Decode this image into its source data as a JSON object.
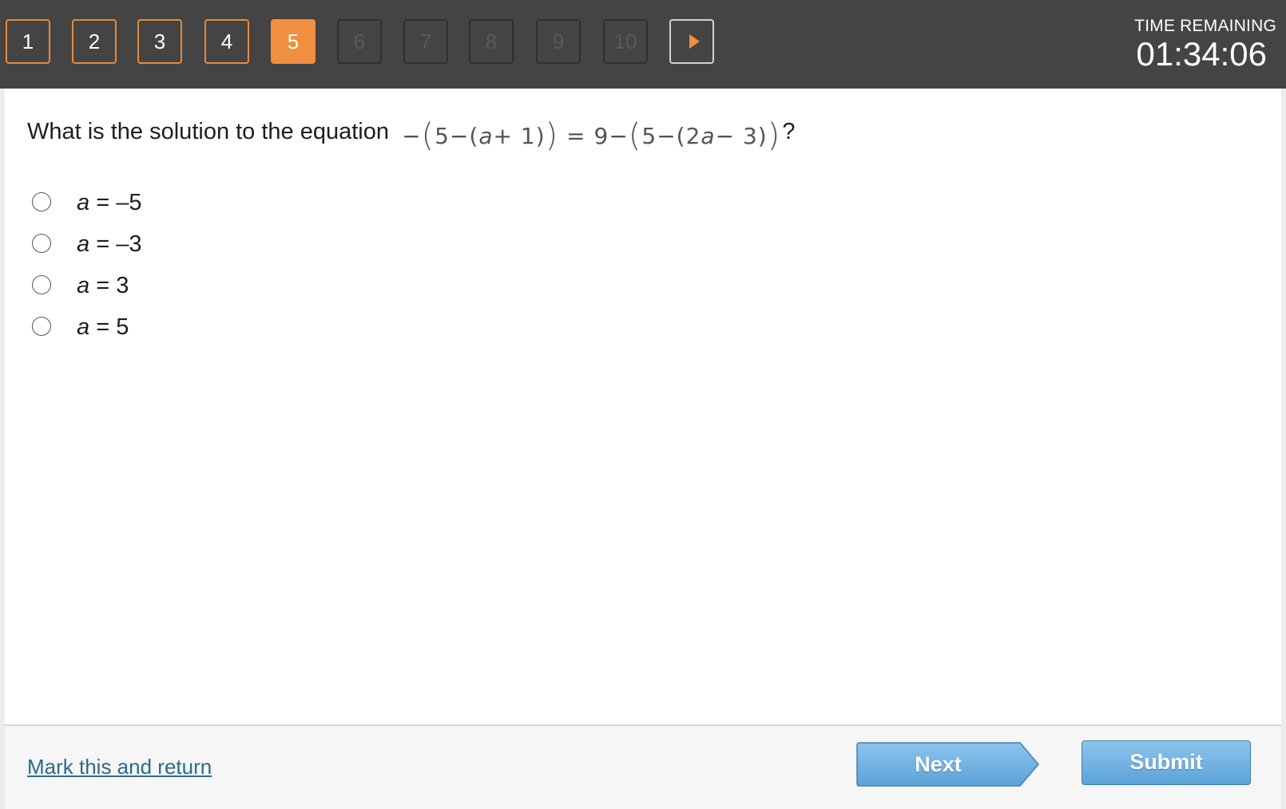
{
  "nav": {
    "questions": [
      {
        "label": "1",
        "state": "answered"
      },
      {
        "label": "2",
        "state": "answered"
      },
      {
        "label": "3",
        "state": "answered"
      },
      {
        "label": "4",
        "state": "answered"
      },
      {
        "label": "5",
        "state": "current"
      },
      {
        "label": "6",
        "state": "disabled"
      },
      {
        "label": "7",
        "state": "disabled"
      },
      {
        "label": "8",
        "state": "disabled"
      },
      {
        "label": "9",
        "state": "disabled"
      },
      {
        "label": "10",
        "state": "disabled"
      }
    ],
    "next_arrow_icon": "play-arrow-icon",
    "accent_color": "#ef8f3f"
  },
  "timer": {
    "label": "TIME REMAINING",
    "value": "01:34:06"
  },
  "question": {
    "prompt": "What is the solution to the equation",
    "equation_parts": [
      "−",
      "(",
      "5−(",
      "a",
      "+ 1)",
      ")",
      " = 9−",
      "(",
      "5−(2",
      "a",
      "− 3)",
      ")"
    ],
    "suffix": "?"
  },
  "options": [
    {
      "var": "a",
      "rest": " = –5"
    },
    {
      "var": "a",
      "rest": " = –3"
    },
    {
      "var": "a",
      "rest": " = 3"
    },
    {
      "var": "a",
      "rest": " = 5"
    }
  ],
  "footer": {
    "mark_label": "Mark this and return",
    "next_label": "Next",
    "submit_label": "Submit"
  }
}
